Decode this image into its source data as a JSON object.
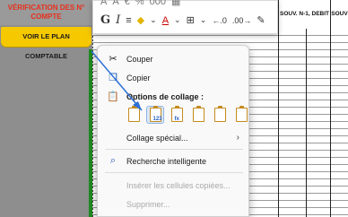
{
  "left_panel": {
    "verification_title": "VÉRIFICATION DES N° COMPTE",
    "plan_button": "VOIR LE PLAN COMPTABLE"
  },
  "sheet": {
    "columns": [
      "SOUV. N-1, DEBIT",
      "SOUV"
    ]
  },
  "mini_toolbar": {
    "bold": "G",
    "italic": "I",
    "row2_percent": "%",
    "row2_dec": "000"
  },
  "context_menu": {
    "items": [
      {
        "label": "Couper",
        "icon": "scissors-icon",
        "disabled": false
      },
      {
        "label": "Copier",
        "icon": "copy-icon",
        "disabled": false
      },
      {
        "label": "Options de collage :",
        "icon": "paste-icon",
        "heading": true
      }
    ],
    "paste_options": [
      {
        "icon": "paste-default-icon",
        "sub": "",
        "selected": false
      },
      {
        "icon": "paste-values-icon",
        "sub": "123",
        "selected": true
      },
      {
        "icon": "paste-formulas-icon",
        "sub": "fx",
        "selected": false
      },
      {
        "icon": "paste-transpose-icon",
        "sub": "",
        "selected": false
      },
      {
        "icon": "paste-formatting-icon",
        "sub": "",
        "selected": false
      },
      {
        "icon": "paste-link-icon",
        "sub": "",
        "selected": false
      }
    ],
    "paste_special": "Collage spécial...",
    "smart_lookup": "Recherche intelligente",
    "insert_copied": "Insérer les cellules copiées...",
    "delete": "Supprimer..."
  },
  "colors": {
    "accent_yellow": "#f5c800",
    "title_red": "#e8301c",
    "grid_green": "#1f8a1f",
    "selection_blue": "#dbe8f8"
  }
}
